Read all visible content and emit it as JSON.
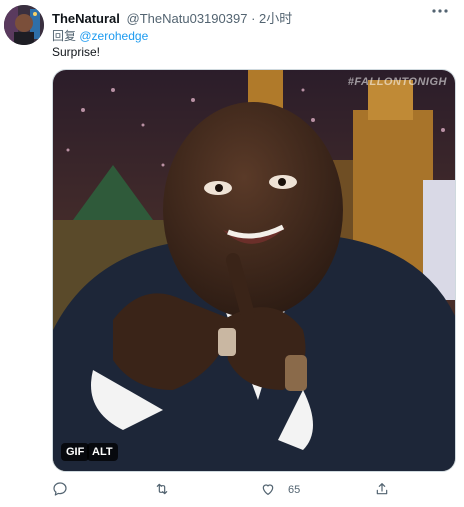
{
  "tweet": {
    "display_name": "TheNatural",
    "handle": "@TheNatu03190397",
    "dot": "·",
    "time": "2小时",
    "reply_prefix": "回复",
    "reply_to": "@zerohedge",
    "text": "Surprise!",
    "media": {
      "gif_badge": "GIF",
      "alt_badge": "ALT",
      "watermark": "#FALLONTONIGH"
    },
    "actions": {
      "reply_icon": "comment-icon",
      "retweet_icon": "retweet-icon",
      "like_icon": "heart-icon",
      "like_count": "65",
      "share_icon": "share-icon"
    }
  },
  "colors": {
    "accent": "#1d9bf0",
    "secondary_text": "#536471",
    "primary_text": "#0f1419"
  }
}
